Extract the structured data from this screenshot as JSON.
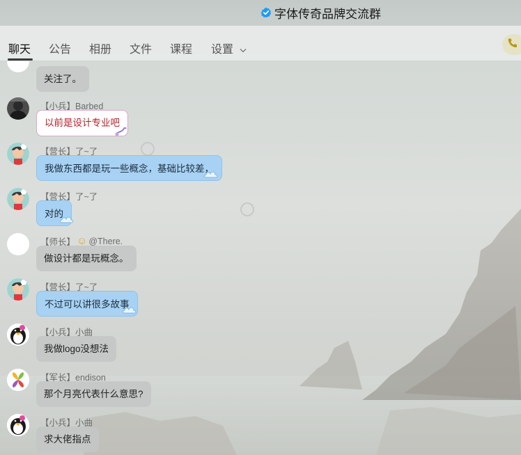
{
  "window": {
    "title": "字体传奇品牌交流群",
    "verified_icon": "verified-badge-icon"
  },
  "tabs": [
    {
      "label": "聊天",
      "active": true
    },
    {
      "label": "公告",
      "active": false
    },
    {
      "label": "相册",
      "active": false
    },
    {
      "label": "文件",
      "active": false
    },
    {
      "label": "课程",
      "active": false
    },
    {
      "label": "设置",
      "active": false,
      "has_dropdown": true
    }
  ],
  "toolbar": {
    "call_icon": "phone-icon"
  },
  "messages": [
    {
      "sender": "",
      "text": "关注了。",
      "style": "gray",
      "avatar": "blank"
    },
    {
      "sender": "【小兵】Barbed",
      "text": "以前是设计专业吧",
      "style": "pink",
      "avatar": "dark-person"
    },
    {
      "sender": "【营长】了~了",
      "text": "我做东西都是玩一些概念，基础比较差，",
      "style": "blue",
      "avatar": "cartoon-boy"
    },
    {
      "sender": "【营长】了~了",
      "text": "对的",
      "style": "blue",
      "avatar": "cartoon-boy"
    },
    {
      "sender_prefix": "【师长】",
      "sender_emoji": "☺",
      "sender": "@There.",
      "text": "做设计都是玩概念。",
      "style": "gray",
      "avatar": "blank"
    },
    {
      "sender": "【营长】了~了",
      "text": "不过可以讲很多故事",
      "style": "blue",
      "avatar": "cartoon-boy"
    },
    {
      "sender": "【小兵】小曲",
      "text": "我做logo没想法",
      "style": "gray",
      "avatar": "penguin"
    },
    {
      "sender": "【军长】endison",
      "text": "那个月亮代表什么意思?",
      "style": "gray",
      "avatar": "pinwheel"
    },
    {
      "sender": "【小兵】小曲",
      "text": "求大佬指点",
      "style": "gray",
      "avatar": "penguin"
    }
  ],
  "colors": {
    "bubble_blue": "#a8d2f4",
    "bubble_gray": "#c4c6c6",
    "pink_text": "#b4222a",
    "verified": "#1e9bf0"
  }
}
